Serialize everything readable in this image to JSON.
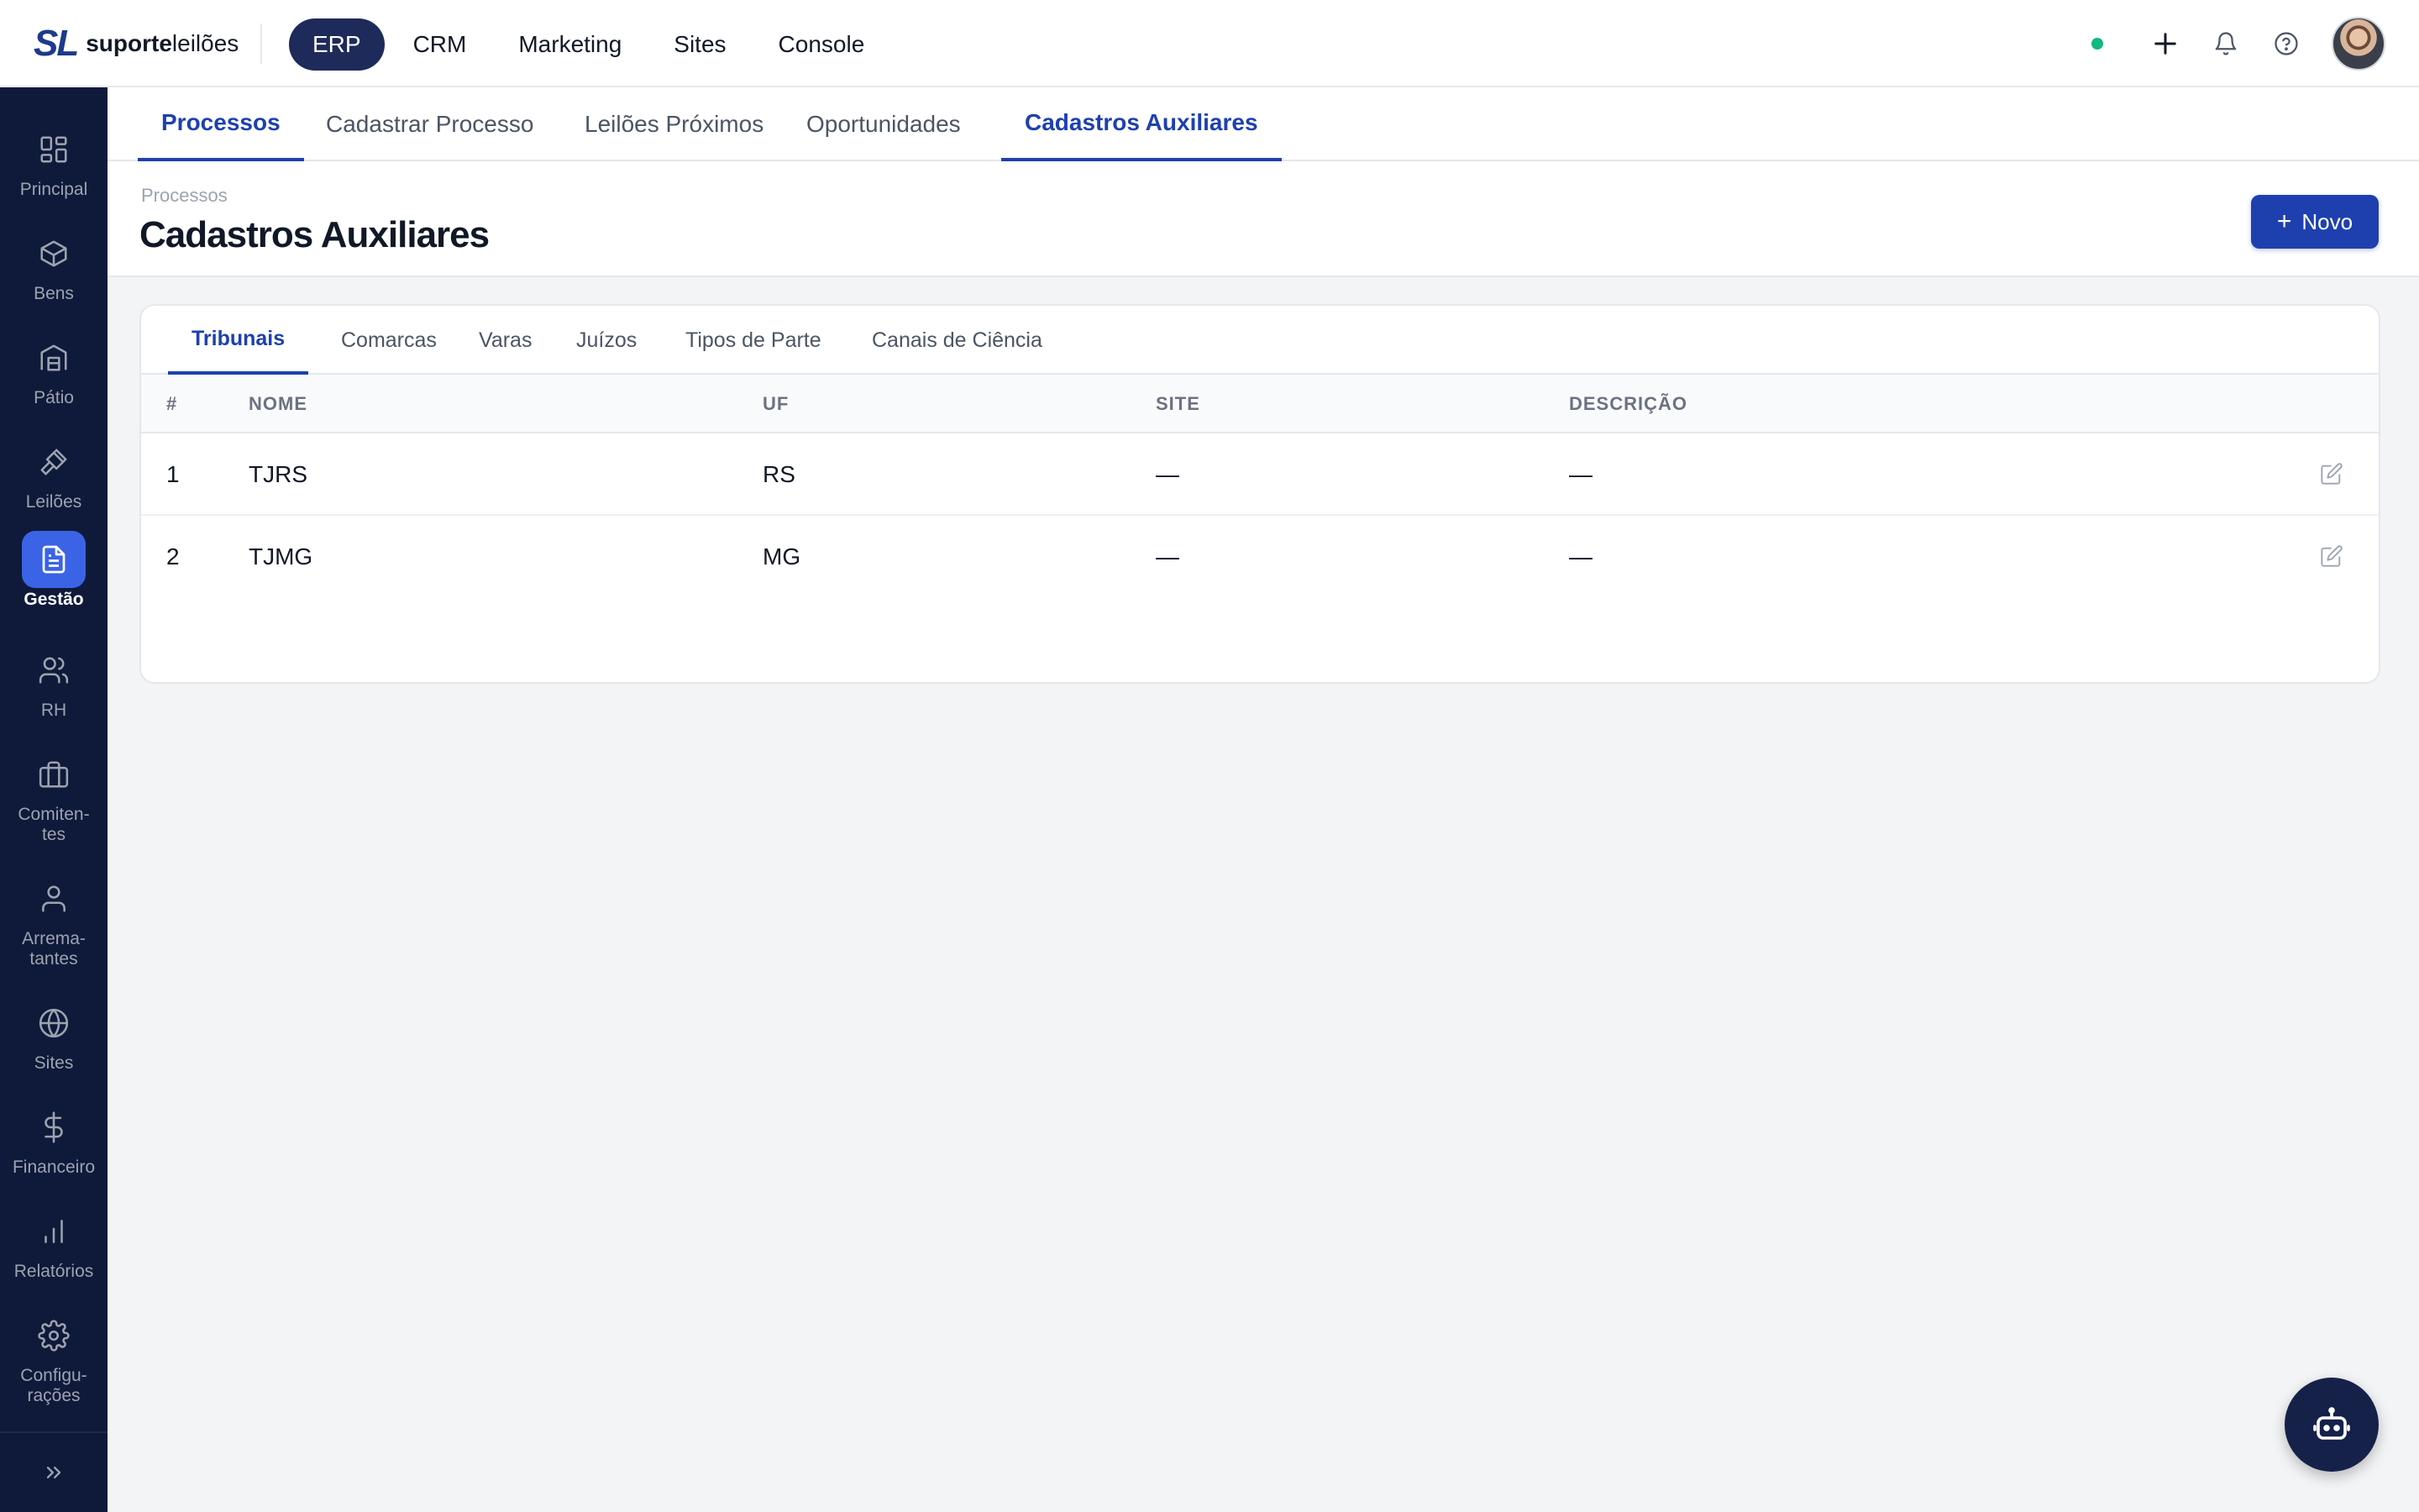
{
  "brand": {
    "mark": "SL",
    "name_bold": "suporte",
    "name_light": "leilões"
  },
  "topnav": [
    {
      "label": "ERP",
      "active": true
    },
    {
      "label": "CRM"
    },
    {
      "label": "Marketing"
    },
    {
      "label": "Sites"
    },
    {
      "label": "Console"
    }
  ],
  "status_color": "#10b981",
  "icons": {
    "add": "plus-icon",
    "notifications": "bell-icon",
    "help": "help-circle-icon",
    "avatar": "user-avatar"
  },
  "sidebar": {
    "items": [
      {
        "label": "Principal",
        "icon": "dashboard-icon"
      },
      {
        "label": "Bens",
        "icon": "box-icon"
      },
      {
        "label": "Pátio",
        "icon": "warehouse-icon"
      },
      {
        "label": "Leilões",
        "icon": "gavel-icon"
      },
      {
        "label": "Gestão",
        "icon": "document-icon",
        "active": true
      },
      {
        "label": "RH",
        "icon": "users-icon"
      },
      {
        "label": "Comiten-\ntes",
        "icon": "briefcase-icon"
      },
      {
        "label": "Arrema-\ntantes",
        "icon": "user-icon"
      },
      {
        "label": "Sites",
        "icon": "globe-icon"
      },
      {
        "label": "Financeiro",
        "icon": "dollar-icon"
      },
      {
        "label": "Relatórios",
        "icon": "bar-chart-icon"
      },
      {
        "label": "Configu-\nrações",
        "icon": "gear-icon"
      }
    ],
    "expand_icon": "chevrons-right-icon"
  },
  "subnav": [
    {
      "label": "Processos",
      "active": true
    },
    {
      "label": "Cadastrar Processo"
    },
    {
      "label": "Leilões Próximos"
    },
    {
      "label": "Oportunidades"
    },
    {
      "label": "Cadastros Auxiliares",
      "active": true
    }
  ],
  "page": {
    "breadcrumb": "Processos",
    "title": "Cadastros Auxiliares",
    "new_button": "Novo"
  },
  "card": {
    "tabs": [
      {
        "label": "Tribunais",
        "active": true
      },
      {
        "label": "Comarcas"
      },
      {
        "label": "Varas"
      },
      {
        "label": "Juízos"
      },
      {
        "label": "Tipos de Parte"
      },
      {
        "label": "Canais de Ciência"
      }
    ],
    "columns": [
      "#",
      "NOME",
      "UF",
      "SITE",
      "DESCRIÇÃO"
    ],
    "rows": [
      {
        "num": "1",
        "nome": "TJRS",
        "uf": "RS",
        "site": "—",
        "descricao": "—"
      },
      {
        "num": "2",
        "nome": "TJMG",
        "uf": "MG",
        "site": "—",
        "descricao": "—"
      }
    ]
  },
  "colors": {
    "primary": "#1e40af",
    "sidebar_bg": "#0f1a3a",
    "active_nav": "#1e2a5a",
    "sidebar_active": "#3b63e6"
  }
}
